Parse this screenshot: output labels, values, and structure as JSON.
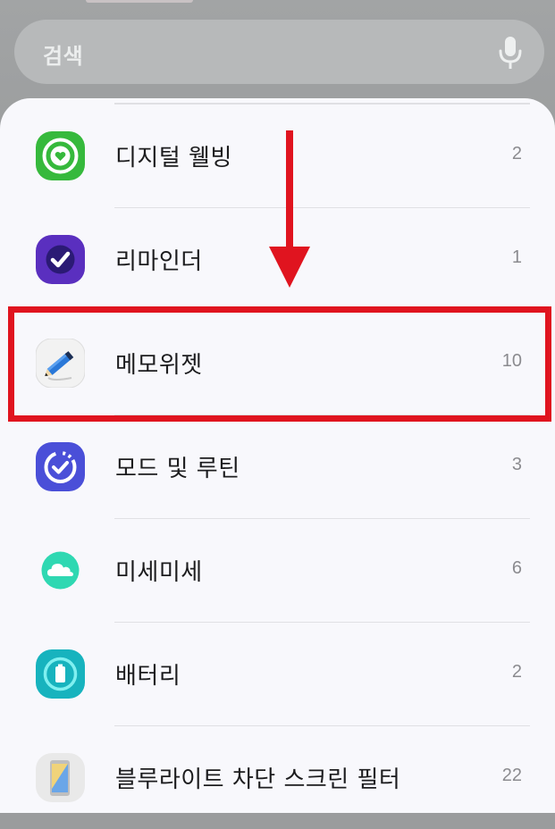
{
  "search": {
    "placeholder": "검색",
    "mic_icon": "microphone-icon"
  },
  "items": [
    {
      "name": "디지털 웰빙",
      "count": "2",
      "icon": "digital-wellbeing-icon",
      "color": "#2fb43a"
    },
    {
      "name": "리마인더",
      "count": "1",
      "icon": "reminder-icon",
      "color": "#4b2aa8"
    },
    {
      "name": "메모위젯",
      "count": "10",
      "icon": "memo-widget-icon",
      "color": "#1d6fd6",
      "highlighted": true
    },
    {
      "name": "모드 및 루틴",
      "count": "3",
      "icon": "modes-routines-icon",
      "color": "#4a4fd8"
    },
    {
      "name": "미세미세",
      "count": "6",
      "icon": "cloud-icon",
      "color": "#2fd8b2"
    },
    {
      "name": "배터리",
      "count": "2",
      "icon": "battery-icon",
      "color": "#17b7c0"
    },
    {
      "name": "블루라이트 차단 스크린 필터",
      "count": "22",
      "icon": "blue-light-filter-icon",
      "color": "#4f8bd8"
    }
  ],
  "annotation": {
    "arrow_color": "#e0141f",
    "box_color": "#e0141f"
  }
}
